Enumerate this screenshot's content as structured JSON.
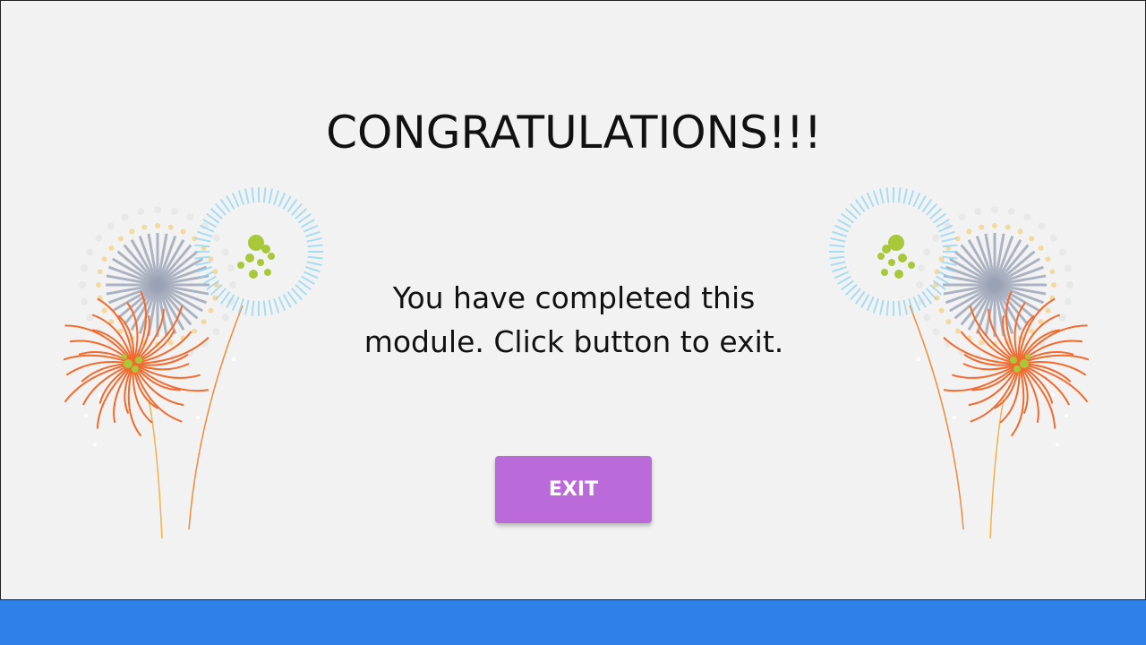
{
  "slide": {
    "title": "CONGRATULATIONS!!!",
    "message": "You have completed this module. Click button to exit.",
    "exit_label": "EXIT"
  },
  "colors": {
    "background": "#f2f2f2",
    "button": "#bb6bd9",
    "footer": "#2f80e8",
    "firework_orange": "#f26a2e",
    "firework_green": "#a8c83a",
    "firework_blue": "#8fd6f2",
    "firework_gray": "#9aa3b5"
  },
  "decorations": {
    "left_icon": "fireworks-icon",
    "right_icon": "fireworks-icon"
  }
}
